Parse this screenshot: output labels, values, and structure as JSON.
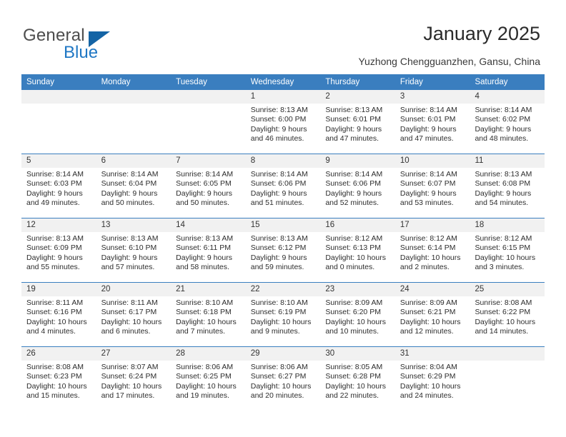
{
  "brand": {
    "general": "General",
    "blue": "Blue",
    "triangle_icon": "triangle-logo-icon",
    "accent_color": "#1464a5"
  },
  "header": {
    "title": "January 2025",
    "subtitle": "Yuzhong Chengguanzhen, Gansu, China"
  },
  "colors": {
    "header_blue": "#3a7ebf",
    "number_band": "#f1f1f1",
    "text": "#2d2d2d"
  },
  "weekdays": [
    "Sunday",
    "Monday",
    "Tuesday",
    "Wednesday",
    "Thursday",
    "Friday",
    "Saturday"
  ],
  "weeks": [
    [
      {
        "day": "",
        "lines": []
      },
      {
        "day": "",
        "lines": []
      },
      {
        "day": "",
        "lines": []
      },
      {
        "day": "1",
        "lines": [
          "Sunrise: 8:13 AM",
          "Sunset: 6:00 PM",
          "Daylight: 9 hours",
          "and 46 minutes."
        ]
      },
      {
        "day": "2",
        "lines": [
          "Sunrise: 8:13 AM",
          "Sunset: 6:01 PM",
          "Daylight: 9 hours",
          "and 47 minutes."
        ]
      },
      {
        "day": "3",
        "lines": [
          "Sunrise: 8:14 AM",
          "Sunset: 6:01 PM",
          "Daylight: 9 hours",
          "and 47 minutes."
        ]
      },
      {
        "day": "4",
        "lines": [
          "Sunrise: 8:14 AM",
          "Sunset: 6:02 PM",
          "Daylight: 9 hours",
          "and 48 minutes."
        ]
      }
    ],
    [
      {
        "day": "5",
        "lines": [
          "Sunrise: 8:14 AM",
          "Sunset: 6:03 PM",
          "Daylight: 9 hours",
          "and 49 minutes."
        ]
      },
      {
        "day": "6",
        "lines": [
          "Sunrise: 8:14 AM",
          "Sunset: 6:04 PM",
          "Daylight: 9 hours",
          "and 50 minutes."
        ]
      },
      {
        "day": "7",
        "lines": [
          "Sunrise: 8:14 AM",
          "Sunset: 6:05 PM",
          "Daylight: 9 hours",
          "and 50 minutes."
        ]
      },
      {
        "day": "8",
        "lines": [
          "Sunrise: 8:14 AM",
          "Sunset: 6:06 PM",
          "Daylight: 9 hours",
          "and 51 minutes."
        ]
      },
      {
        "day": "9",
        "lines": [
          "Sunrise: 8:14 AM",
          "Sunset: 6:06 PM",
          "Daylight: 9 hours",
          "and 52 minutes."
        ]
      },
      {
        "day": "10",
        "lines": [
          "Sunrise: 8:14 AM",
          "Sunset: 6:07 PM",
          "Daylight: 9 hours",
          "and 53 minutes."
        ]
      },
      {
        "day": "11",
        "lines": [
          "Sunrise: 8:13 AM",
          "Sunset: 6:08 PM",
          "Daylight: 9 hours",
          "and 54 minutes."
        ]
      }
    ],
    [
      {
        "day": "12",
        "lines": [
          "Sunrise: 8:13 AM",
          "Sunset: 6:09 PM",
          "Daylight: 9 hours",
          "and 55 minutes."
        ]
      },
      {
        "day": "13",
        "lines": [
          "Sunrise: 8:13 AM",
          "Sunset: 6:10 PM",
          "Daylight: 9 hours",
          "and 57 minutes."
        ]
      },
      {
        "day": "14",
        "lines": [
          "Sunrise: 8:13 AM",
          "Sunset: 6:11 PM",
          "Daylight: 9 hours",
          "and 58 minutes."
        ]
      },
      {
        "day": "15",
        "lines": [
          "Sunrise: 8:13 AM",
          "Sunset: 6:12 PM",
          "Daylight: 9 hours",
          "and 59 minutes."
        ]
      },
      {
        "day": "16",
        "lines": [
          "Sunrise: 8:12 AM",
          "Sunset: 6:13 PM",
          "Daylight: 10 hours",
          "and 0 minutes."
        ]
      },
      {
        "day": "17",
        "lines": [
          "Sunrise: 8:12 AM",
          "Sunset: 6:14 PM",
          "Daylight: 10 hours",
          "and 2 minutes."
        ]
      },
      {
        "day": "18",
        "lines": [
          "Sunrise: 8:12 AM",
          "Sunset: 6:15 PM",
          "Daylight: 10 hours",
          "and 3 minutes."
        ]
      }
    ],
    [
      {
        "day": "19",
        "lines": [
          "Sunrise: 8:11 AM",
          "Sunset: 6:16 PM",
          "Daylight: 10 hours",
          "and 4 minutes."
        ]
      },
      {
        "day": "20",
        "lines": [
          "Sunrise: 8:11 AM",
          "Sunset: 6:17 PM",
          "Daylight: 10 hours",
          "and 6 minutes."
        ]
      },
      {
        "day": "21",
        "lines": [
          "Sunrise: 8:10 AM",
          "Sunset: 6:18 PM",
          "Daylight: 10 hours",
          "and 7 minutes."
        ]
      },
      {
        "day": "22",
        "lines": [
          "Sunrise: 8:10 AM",
          "Sunset: 6:19 PM",
          "Daylight: 10 hours",
          "and 9 minutes."
        ]
      },
      {
        "day": "23",
        "lines": [
          "Sunrise: 8:09 AM",
          "Sunset: 6:20 PM",
          "Daylight: 10 hours",
          "and 10 minutes."
        ]
      },
      {
        "day": "24",
        "lines": [
          "Sunrise: 8:09 AM",
          "Sunset: 6:21 PM",
          "Daylight: 10 hours",
          "and 12 minutes."
        ]
      },
      {
        "day": "25",
        "lines": [
          "Sunrise: 8:08 AM",
          "Sunset: 6:22 PM",
          "Daylight: 10 hours",
          "and 14 minutes."
        ]
      }
    ],
    [
      {
        "day": "26",
        "lines": [
          "Sunrise: 8:08 AM",
          "Sunset: 6:23 PM",
          "Daylight: 10 hours",
          "and 15 minutes."
        ]
      },
      {
        "day": "27",
        "lines": [
          "Sunrise: 8:07 AM",
          "Sunset: 6:24 PM",
          "Daylight: 10 hours",
          "and 17 minutes."
        ]
      },
      {
        "day": "28",
        "lines": [
          "Sunrise: 8:06 AM",
          "Sunset: 6:25 PM",
          "Daylight: 10 hours",
          "and 19 minutes."
        ]
      },
      {
        "day": "29",
        "lines": [
          "Sunrise: 8:06 AM",
          "Sunset: 6:27 PM",
          "Daylight: 10 hours",
          "and 20 minutes."
        ]
      },
      {
        "day": "30",
        "lines": [
          "Sunrise: 8:05 AM",
          "Sunset: 6:28 PM",
          "Daylight: 10 hours",
          "and 22 minutes."
        ]
      },
      {
        "day": "31",
        "lines": [
          "Sunrise: 8:04 AM",
          "Sunset: 6:29 PM",
          "Daylight: 10 hours",
          "and 24 minutes."
        ]
      },
      {
        "day": "",
        "lines": []
      }
    ]
  ]
}
